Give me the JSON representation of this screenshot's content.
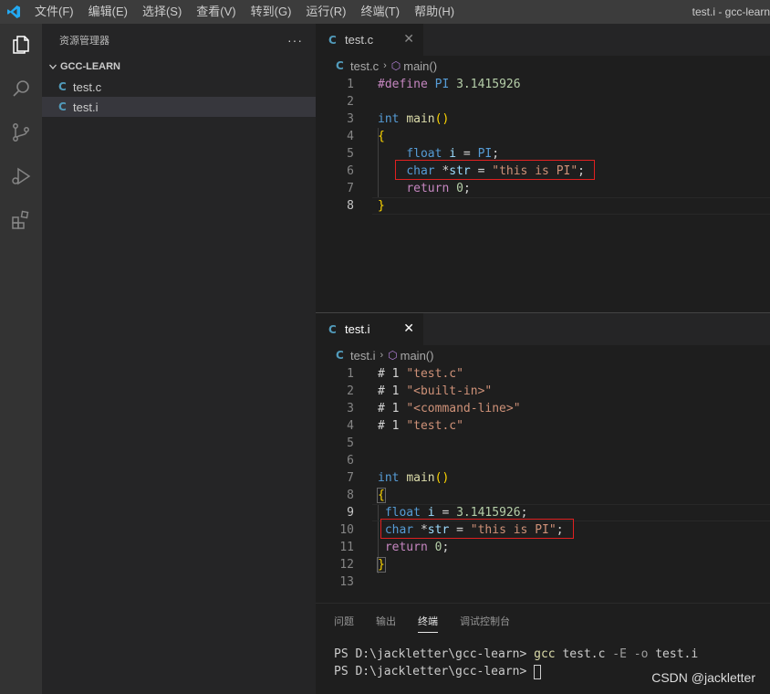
{
  "titlebar": {
    "menus": [
      "文件(F)",
      "编辑(E)",
      "选择(S)",
      "查看(V)",
      "转到(G)",
      "运行(R)",
      "终端(T)",
      "帮助(H)"
    ],
    "window_title": "test.i - gcc-learn"
  },
  "activity_bar": {
    "icons": [
      "explorer-icon",
      "search-icon",
      "source-control-icon",
      "run-debug-icon",
      "extensions-icon"
    ]
  },
  "sidebar": {
    "title": "资源管理器",
    "more": "···",
    "section": "GCC-LEARN",
    "files": [
      {
        "icon": "C",
        "name": "test.c"
      },
      {
        "icon": "C",
        "name": "test.i"
      }
    ]
  },
  "editor_top": {
    "tab": {
      "icon": "C",
      "label": "test.c",
      "close": "✕"
    },
    "breadcrumb": {
      "file": "test.c",
      "sep": "›",
      "symbol": "main()"
    },
    "lines": [
      "1",
      "2",
      "3",
      "4",
      "5",
      "6",
      "7",
      "8"
    ],
    "code": {
      "l1_directive": "#define",
      "l1_name": "PI",
      "l1_value": "3.1415926",
      "l3_type": "int",
      "l3_func": "main",
      "l3_parens": "()",
      "l4_brace": "{",
      "l5_type": "float",
      "l5_var": "i",
      "l5_eq": " = ",
      "l5_val": "PI",
      "l5_semi": ";",
      "l6_type": "char",
      "l6_ptr": " *",
      "l6_var": "str",
      "l6_eq": " = ",
      "l6_str": "\"this is PI\"",
      "l6_semi": ";",
      "l7_kw": "return",
      "l7_num": "0",
      "l7_semi": ";",
      "l8_brace": "}"
    }
  },
  "editor_bottom": {
    "tab": {
      "icon": "C",
      "label": "test.i",
      "close": "✕"
    },
    "breadcrumb": {
      "file": "test.i",
      "sep": "›",
      "symbol": "main()"
    },
    "lines": [
      "1",
      "2",
      "3",
      "4",
      "5",
      "6",
      "7",
      "8",
      "9",
      "10",
      "11",
      "12",
      "13"
    ],
    "code": {
      "hash": "# 1",
      "l1_str": "\"test.c\"",
      "l2_str": "\"<built-in>\"",
      "l3_str": "\"<command-line>\"",
      "l4_str": "\"test.c\"",
      "l7_type": "int",
      "l7_func": "main",
      "l7_parens": "()",
      "l8_brace": "{",
      "l9_type": "float",
      "l9_var": "i",
      "l9_eq": " = ",
      "l9_num": "3.1415926",
      "l9_semi": ";",
      "l10_type": "char",
      "l10_ptr": " *",
      "l10_var": "str",
      "l10_eq": " = ",
      "l10_str": "\"this is PI\"",
      "l10_semi": ";",
      "l11_kw": "return",
      "l11_num": "0",
      "l11_semi": ";",
      "l12_brace": "}"
    }
  },
  "panel": {
    "tabs": [
      "问题",
      "输出",
      "终端",
      "调试控制台"
    ],
    "active_tab": "终端",
    "terminal": {
      "line1_prompt": "PS D:\\jackletter\\gcc-learn> ",
      "line1_cmd": "gcc",
      "line1_file": " test.c ",
      "line1_flag_e": "-E",
      "line1_flag_o": " -o ",
      "line1_out": "test.i",
      "line2_prompt": "PS D:\\jackletter\\gcc-learn> "
    }
  },
  "watermark": "CSDN @jackletter",
  "colors": {
    "accent_blue": "#569cd6",
    "highlight_box": "#e02020",
    "vscode_logo": "#23a9f2"
  }
}
